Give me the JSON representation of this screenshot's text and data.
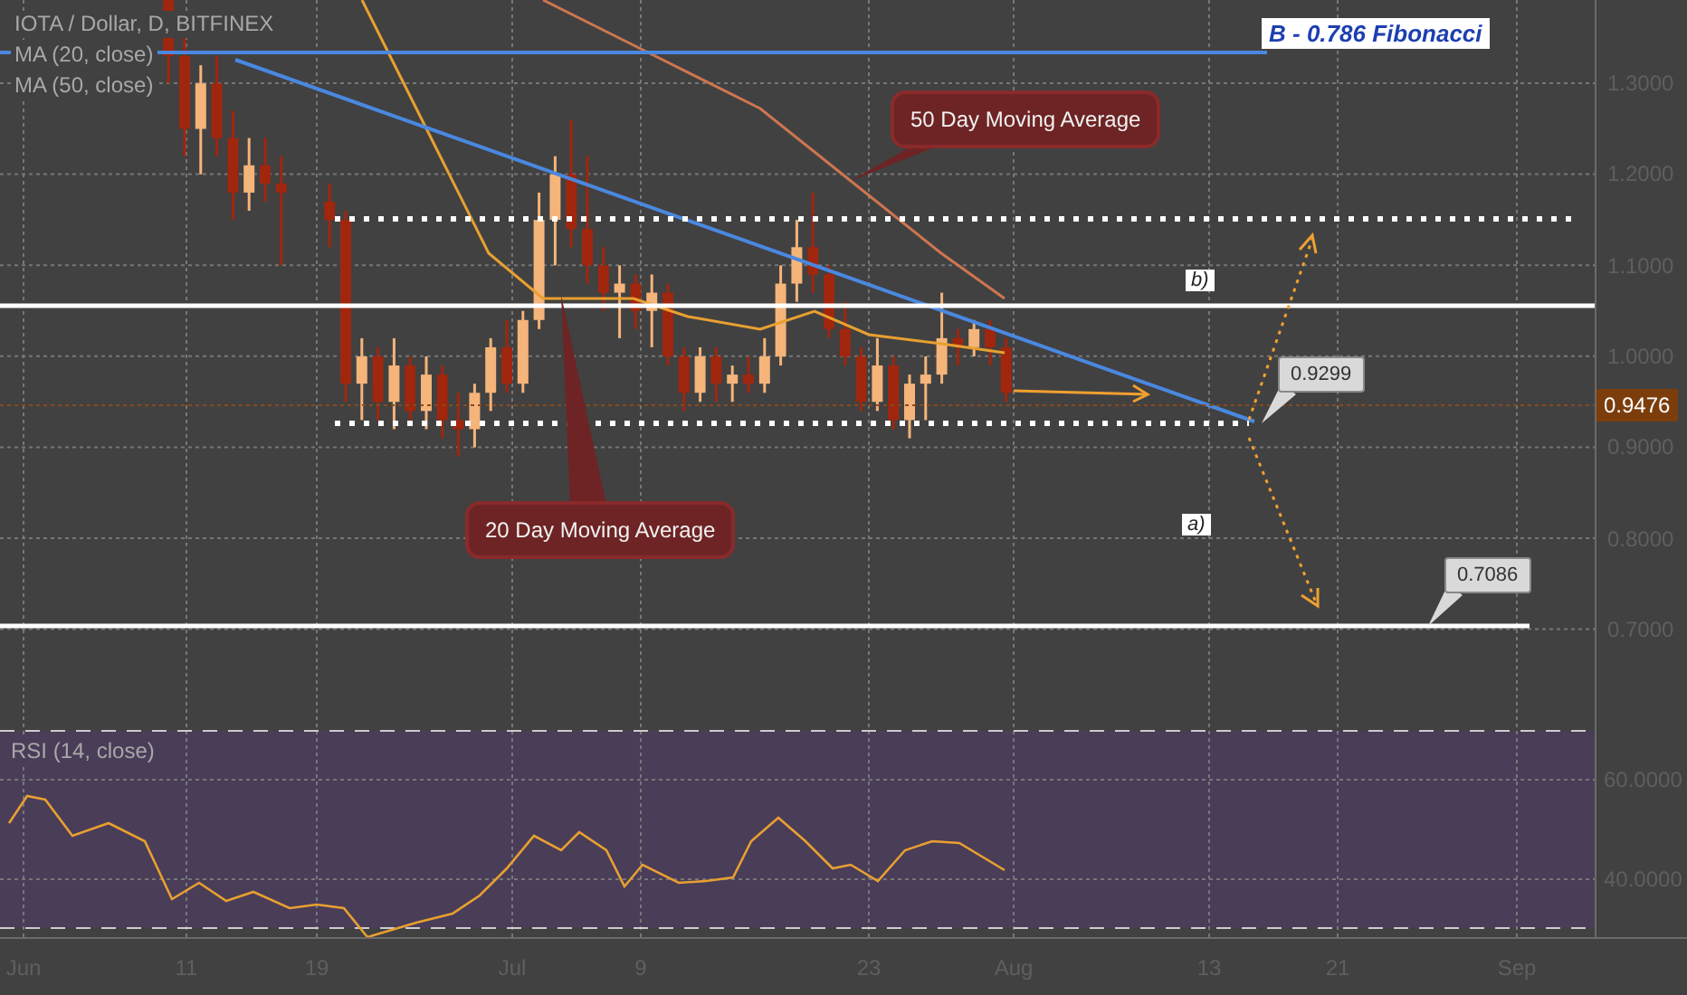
{
  "legend": {
    "symbol": "IOTA / Dollar, D, BITFINEX",
    "indicators": [
      "MA (20, close)",
      "MA (50, close)"
    ]
  },
  "annotations": [
    {
      "kind": "label",
      "text": "B - 0.786 Fibonacci"
    },
    {
      "kind": "callout",
      "text": "50 Day Moving Average"
    },
    {
      "kind": "callout",
      "text": "20 Day Moving Average"
    },
    {
      "kind": "wave",
      "text": "b)"
    },
    {
      "kind": "wave",
      "text": "a)"
    },
    {
      "kind": "price",
      "text": "0.9299"
    },
    {
      "kind": "price",
      "text": "0.7086"
    }
  ],
  "price_axis": {
    "ticks": [
      "1.3000",
      "1.2000",
      "1.1000",
      "1.0000",
      "0.9000",
      "0.8000",
      "0.7000"
    ],
    "current_price": "0.9476"
  },
  "rsi_pane": {
    "title": "RSI (14, close)",
    "ticks": [
      "60.0000",
      "40.0000"
    ]
  },
  "time_axis": {
    "ticks": [
      "Jun",
      "11",
      "19",
      "Jul",
      "9",
      "23",
      "Aug",
      "13",
      "21",
      "Sep"
    ]
  }
}
